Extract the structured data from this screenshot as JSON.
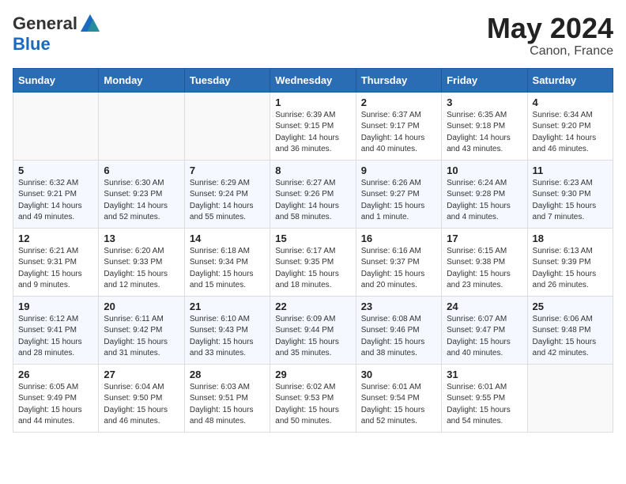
{
  "header": {
    "logo_general": "General",
    "logo_blue": "Blue",
    "month": "May 2024",
    "location": "Canon, France"
  },
  "days_of_week": [
    "Sunday",
    "Monday",
    "Tuesday",
    "Wednesday",
    "Thursday",
    "Friday",
    "Saturday"
  ],
  "weeks": [
    [
      {
        "day": "",
        "info": ""
      },
      {
        "day": "",
        "info": ""
      },
      {
        "day": "",
        "info": ""
      },
      {
        "day": "1",
        "info": "Sunrise: 6:39 AM\nSunset: 9:15 PM\nDaylight: 14 hours\nand 36 minutes."
      },
      {
        "day": "2",
        "info": "Sunrise: 6:37 AM\nSunset: 9:17 PM\nDaylight: 14 hours\nand 40 minutes."
      },
      {
        "day": "3",
        "info": "Sunrise: 6:35 AM\nSunset: 9:18 PM\nDaylight: 14 hours\nand 43 minutes."
      },
      {
        "day": "4",
        "info": "Sunrise: 6:34 AM\nSunset: 9:20 PM\nDaylight: 14 hours\nand 46 minutes."
      }
    ],
    [
      {
        "day": "5",
        "info": "Sunrise: 6:32 AM\nSunset: 9:21 PM\nDaylight: 14 hours\nand 49 minutes."
      },
      {
        "day": "6",
        "info": "Sunrise: 6:30 AM\nSunset: 9:23 PM\nDaylight: 14 hours\nand 52 minutes."
      },
      {
        "day": "7",
        "info": "Sunrise: 6:29 AM\nSunset: 9:24 PM\nDaylight: 14 hours\nand 55 minutes."
      },
      {
        "day": "8",
        "info": "Sunrise: 6:27 AM\nSunset: 9:26 PM\nDaylight: 14 hours\nand 58 minutes."
      },
      {
        "day": "9",
        "info": "Sunrise: 6:26 AM\nSunset: 9:27 PM\nDaylight: 15 hours\nand 1 minute."
      },
      {
        "day": "10",
        "info": "Sunrise: 6:24 AM\nSunset: 9:28 PM\nDaylight: 15 hours\nand 4 minutes."
      },
      {
        "day": "11",
        "info": "Sunrise: 6:23 AM\nSunset: 9:30 PM\nDaylight: 15 hours\nand 7 minutes."
      }
    ],
    [
      {
        "day": "12",
        "info": "Sunrise: 6:21 AM\nSunset: 9:31 PM\nDaylight: 15 hours\nand 9 minutes."
      },
      {
        "day": "13",
        "info": "Sunrise: 6:20 AM\nSunset: 9:33 PM\nDaylight: 15 hours\nand 12 minutes."
      },
      {
        "day": "14",
        "info": "Sunrise: 6:18 AM\nSunset: 9:34 PM\nDaylight: 15 hours\nand 15 minutes."
      },
      {
        "day": "15",
        "info": "Sunrise: 6:17 AM\nSunset: 9:35 PM\nDaylight: 15 hours\nand 18 minutes."
      },
      {
        "day": "16",
        "info": "Sunrise: 6:16 AM\nSunset: 9:37 PM\nDaylight: 15 hours\nand 20 minutes."
      },
      {
        "day": "17",
        "info": "Sunrise: 6:15 AM\nSunset: 9:38 PM\nDaylight: 15 hours\nand 23 minutes."
      },
      {
        "day": "18",
        "info": "Sunrise: 6:13 AM\nSunset: 9:39 PM\nDaylight: 15 hours\nand 26 minutes."
      }
    ],
    [
      {
        "day": "19",
        "info": "Sunrise: 6:12 AM\nSunset: 9:41 PM\nDaylight: 15 hours\nand 28 minutes."
      },
      {
        "day": "20",
        "info": "Sunrise: 6:11 AM\nSunset: 9:42 PM\nDaylight: 15 hours\nand 31 minutes."
      },
      {
        "day": "21",
        "info": "Sunrise: 6:10 AM\nSunset: 9:43 PM\nDaylight: 15 hours\nand 33 minutes."
      },
      {
        "day": "22",
        "info": "Sunrise: 6:09 AM\nSunset: 9:44 PM\nDaylight: 15 hours\nand 35 minutes."
      },
      {
        "day": "23",
        "info": "Sunrise: 6:08 AM\nSunset: 9:46 PM\nDaylight: 15 hours\nand 38 minutes."
      },
      {
        "day": "24",
        "info": "Sunrise: 6:07 AM\nSunset: 9:47 PM\nDaylight: 15 hours\nand 40 minutes."
      },
      {
        "day": "25",
        "info": "Sunrise: 6:06 AM\nSunset: 9:48 PM\nDaylight: 15 hours\nand 42 minutes."
      }
    ],
    [
      {
        "day": "26",
        "info": "Sunrise: 6:05 AM\nSunset: 9:49 PM\nDaylight: 15 hours\nand 44 minutes."
      },
      {
        "day": "27",
        "info": "Sunrise: 6:04 AM\nSunset: 9:50 PM\nDaylight: 15 hours\nand 46 minutes."
      },
      {
        "day": "28",
        "info": "Sunrise: 6:03 AM\nSunset: 9:51 PM\nDaylight: 15 hours\nand 48 minutes."
      },
      {
        "day": "29",
        "info": "Sunrise: 6:02 AM\nSunset: 9:53 PM\nDaylight: 15 hours\nand 50 minutes."
      },
      {
        "day": "30",
        "info": "Sunrise: 6:01 AM\nSunset: 9:54 PM\nDaylight: 15 hours\nand 52 minutes."
      },
      {
        "day": "31",
        "info": "Sunrise: 6:01 AM\nSunset: 9:55 PM\nDaylight: 15 hours\nand 54 minutes."
      },
      {
        "day": "",
        "info": ""
      }
    ]
  ]
}
